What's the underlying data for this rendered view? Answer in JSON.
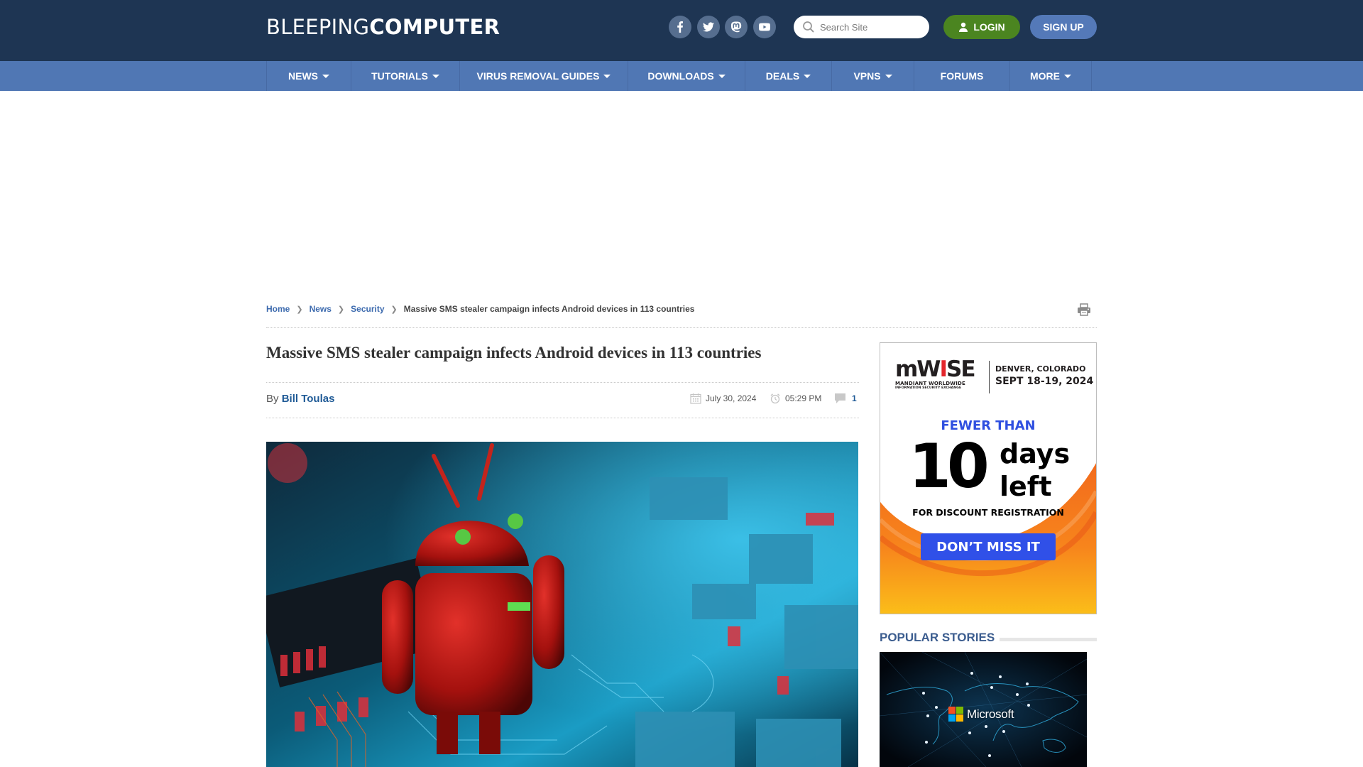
{
  "site": {
    "logo_thin": "BLEEPING",
    "logo_bold": "COMPUTER"
  },
  "header": {
    "social": [
      {
        "name": "facebook-icon"
      },
      {
        "name": "twitter-icon"
      },
      {
        "name": "mastodon-icon"
      },
      {
        "name": "youtube-icon"
      }
    ],
    "search_placeholder": "Search Site",
    "search_value": "",
    "login_label": "LOGIN",
    "signup_label": "SIGN UP"
  },
  "nav": {
    "items": [
      {
        "label": "NEWS",
        "dropdown": true
      },
      {
        "label": "TUTORIALS",
        "dropdown": true
      },
      {
        "label": "VIRUS REMOVAL GUIDES",
        "dropdown": true
      },
      {
        "label": "DOWNLOADS",
        "dropdown": true
      },
      {
        "label": "DEALS",
        "dropdown": true
      },
      {
        "label": "VPNS",
        "dropdown": true
      },
      {
        "label": "FORUMS",
        "dropdown": false
      },
      {
        "label": "MORE",
        "dropdown": true
      }
    ]
  },
  "breadcrumb": {
    "items": [
      "Home",
      "News",
      "Security"
    ],
    "current": "Massive SMS stealer campaign infects Android devices in 113 countries"
  },
  "article": {
    "title": "Massive SMS stealer campaign infects Android devices in 113 countries",
    "by_label": "By",
    "author": "Bill Toulas",
    "date": "July 30, 2024",
    "time": "05:29 PM",
    "comments": "1",
    "hero_alt": "Red Android robot on a circuit board"
  },
  "sidebar": {
    "ad": {
      "brand": "mWISE",
      "brand_sub1": "MANDIANT WORLDWIDE",
      "brand_sub2": "INFORMATION SECURITY EXCHANGE",
      "location": "DENVER, COLORADO",
      "dates": "SEPT 18-19, 2024",
      "fewer_than": "FEWER THAN",
      "number": "10",
      "days": "days",
      "left": "left",
      "registration": "FOR DISCOUNT REGISTRATION",
      "cta": "DON’T MISS IT"
    },
    "popular_heading": "POPULAR STORIES",
    "popular_image_text": "Microsoft"
  },
  "colors": {
    "header_bg": "#1e3553",
    "nav_bg": "#5077b4",
    "login_green": "#4b8520",
    "signup_blue": "#5479b8",
    "link_blue": "#3c6aae",
    "ad_cta_blue": "#3050e8"
  }
}
